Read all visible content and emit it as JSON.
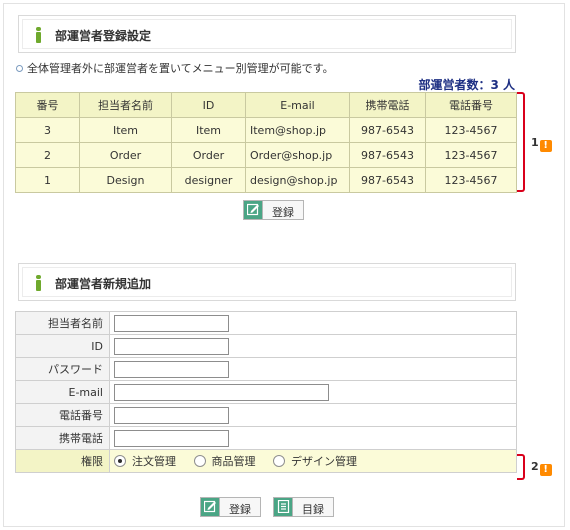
{
  "section1": {
    "title": "部運営者登録設定",
    "note": "全体管理者外に部運営者を置いてメニュー別管理が可能です。",
    "count_text": "部運営者数：3 人"
  },
  "list": {
    "headers": [
      "番号",
      "担当者名前",
      "ID",
      "E-mail",
      "携帯電話",
      "電話番号"
    ],
    "rows": [
      [
        "3",
        "Item",
        "Item",
        "Item@shop.jp",
        "987-6543",
        "123-4567"
      ],
      [
        "2",
        "Order",
        "Order",
        "Order@shop.jp",
        "987-6543",
        "123-4567"
      ],
      [
        "1",
        "Design",
        "designer",
        "design@shop.jp",
        "987-6543",
        "123-4567"
      ]
    ]
  },
  "marker1": "1",
  "marker2": "2",
  "warn_glyph": "!",
  "buttons": {
    "register": "登録",
    "list": "目録"
  },
  "section2": {
    "title": "部運営者新規追加"
  },
  "form": {
    "name_label": "担当者名前",
    "id_label": "ID",
    "password_label": "パスワード",
    "email_label": "E-mail",
    "phone_label": "電話番号",
    "mobile_label": "携帯電話",
    "perm_label": "権限",
    "perm_options": [
      "注文管理",
      "商品管理",
      "デザイン管理"
    ],
    "perm_selected": "注文管理"
  },
  "colors": {
    "accent_green": "#6fa92d",
    "table_yellow": "#fbfbd8",
    "count_blue": "#1d2f83",
    "bracket_red": "#d9001b",
    "warn_orange": "#ff8a00"
  }
}
